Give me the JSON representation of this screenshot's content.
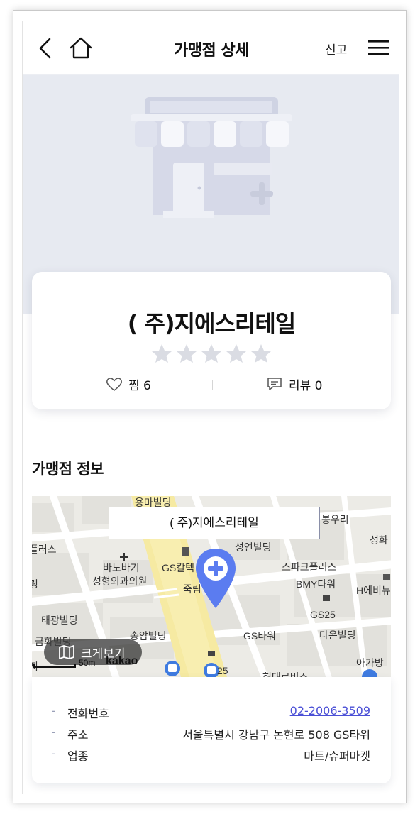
{
  "header": {
    "title": "가맹점 상세",
    "report_label": "신고",
    "back_icon": "chevron-left-icon",
    "home_icon": "home-icon",
    "menu_icon": "hamburger-menu-icon"
  },
  "store": {
    "name": "( 주)지에스리테일",
    "rating": {
      "value": 0,
      "max": 5
    },
    "like_label": "찜 6",
    "review_label": "리뷰 0"
  },
  "section": {
    "title": "가맹점 정보"
  },
  "map": {
    "marker_label": "( 주)지에스리테일",
    "enlarge_label": "크게보기",
    "scale_label": "50m",
    "provider_label": "kakao",
    "places": [
      "용마빌딩",
      "봉우리",
      "성화",
      "플러스",
      "성연빌딩",
      "바노바기",
      "GS칼텍",
      "성형외과의원",
      "스파크플러스",
      "BMY타워",
      "H에비뉴",
      "죽림",
      "GS25",
      "태광빌딩",
      "금화빌딩",
      "송암빌딩",
      "GS타워",
      "다온빌딩",
      "아가방",
      "25",
      "링",
      "지",
      "허대로비스"
    ]
  },
  "details": [
    {
      "label": "전화번호",
      "value": "02-2006-3509",
      "link": true
    },
    {
      "label": "주소",
      "value": "서울특별시 강남구 논현로 508 GS타워",
      "link": false
    },
    {
      "label": "업종",
      "value": "마트/슈퍼마켓",
      "link": false
    }
  ],
  "colors": {
    "accent": "#4a4fd6",
    "marker": "#5b7cf0",
    "hero_bg": "#e7eaf1",
    "star_empty": "#dadce3"
  }
}
